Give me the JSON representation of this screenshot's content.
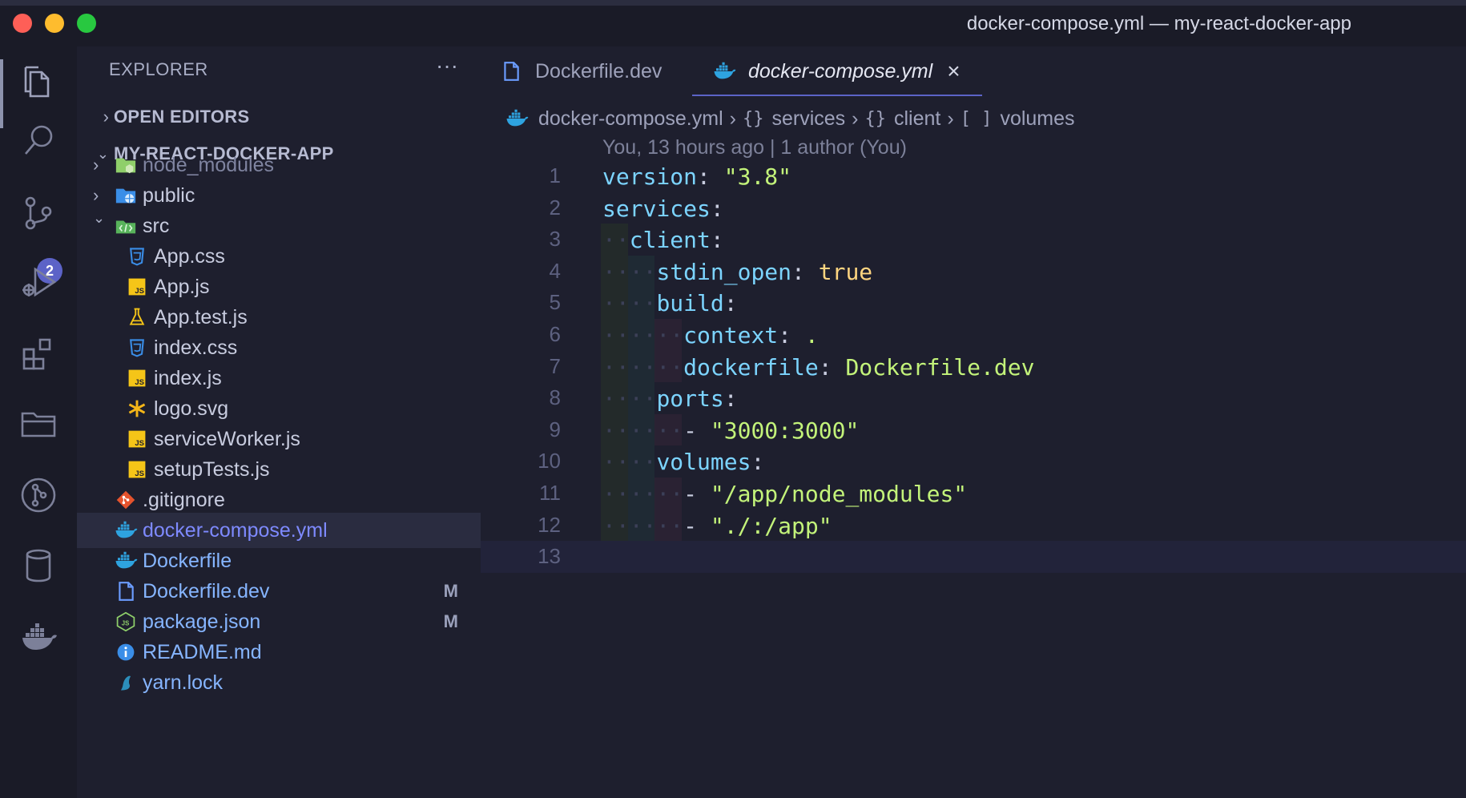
{
  "window": {
    "title": "docker-compose.yml — my-react-docker-app"
  },
  "activity_bar": {
    "items": [
      "files-icon",
      "search-icon",
      "source-control-icon",
      "run-debug-icon",
      "extensions-icon",
      "folder-icon",
      "git-graph-icon",
      "database-icon",
      "docker-icon"
    ],
    "source_control_badge": "2"
  },
  "sidebar": {
    "header": "EXPLORER",
    "more": "···",
    "open_editors_label": "OPEN EDITORS",
    "project_label": "MY-REACT-DOCKER-APP",
    "tree": [
      {
        "name": "node_modules",
        "type": "folder",
        "expanded": false,
        "icon": "node-folder-icon"
      },
      {
        "name": "public",
        "type": "folder",
        "expanded": false,
        "icon": "public-folder-icon"
      },
      {
        "name": "src",
        "type": "folder",
        "expanded": true,
        "icon": "src-folder-icon"
      },
      {
        "name": "App.css",
        "icon": "css-icon"
      },
      {
        "name": "App.js",
        "icon": "js-icon"
      },
      {
        "name": "App.test.js",
        "icon": "test-flask-icon"
      },
      {
        "name": "index.css",
        "icon": "css-icon"
      },
      {
        "name": "index.js",
        "icon": "js-icon"
      },
      {
        "name": "logo.svg",
        "icon": "svg-star-icon"
      },
      {
        "name": "serviceWorker.js",
        "icon": "js-icon"
      },
      {
        "name": "setupTests.js",
        "icon": "js-icon"
      },
      {
        "name": ".gitignore",
        "icon": "git-icon"
      },
      {
        "name": "docker-compose.yml",
        "icon": "docker-icon"
      },
      {
        "name": "Dockerfile",
        "icon": "docker-icon"
      },
      {
        "name": "Dockerfile.dev",
        "icon": "file-icon",
        "status": "M"
      },
      {
        "name": "package.json",
        "icon": "nodejs-icon",
        "status": "M"
      },
      {
        "name": "README.md",
        "icon": "info-icon"
      },
      {
        "name": "yarn.lock",
        "icon": "yarn-icon"
      }
    ]
  },
  "tabs": [
    {
      "label": "Dockerfile.dev",
      "active": false
    },
    {
      "label": "docker-compose.yml",
      "active": true,
      "close": "×"
    }
  ],
  "breadcrumb": {
    "file": "docker-compose.yml",
    "path": [
      {
        "symbol": "{}",
        "label": "services"
      },
      {
        "symbol": "{}",
        "label": "client"
      },
      {
        "symbol": "[ ]",
        "label": "volumes"
      }
    ]
  },
  "codelens": "You, 13 hours ago | 1 author (You)",
  "code": {
    "line_numbers": [
      "1",
      "2",
      "3",
      "4",
      "5",
      "6",
      "7",
      "8",
      "9",
      "10",
      "11",
      "12",
      "13"
    ],
    "lines": [
      {
        "key": "version",
        "punct": ": ",
        "value": "\"3.8\"",
        "vtype": "string"
      },
      {
        "key": "services",
        "punct": ":"
      },
      {
        "key": "client",
        "punct": ":"
      },
      {
        "key": "stdin_open",
        "punct": ": ",
        "value": "true",
        "vtype": "bool"
      },
      {
        "key": "build",
        "punct": ":"
      },
      {
        "key": "context",
        "punct": ": ",
        "value": ".",
        "vtype": "string"
      },
      {
        "key": "dockerfile",
        "punct": ": ",
        "value": "Dockerfile.dev",
        "vtype": "string"
      },
      {
        "key": "ports",
        "punct": ":"
      },
      {
        "dash": "- ",
        "value": "\"3000:3000\"",
        "vtype": "string"
      },
      {
        "key": "volumes",
        "punct": ":"
      },
      {
        "dash": "- ",
        "value": "\"/app/node_modules\"",
        "vtype": "string"
      },
      {
        "dash": "- ",
        "value": "\"./:/app\"",
        "vtype": "string"
      },
      {}
    ]
  }
}
